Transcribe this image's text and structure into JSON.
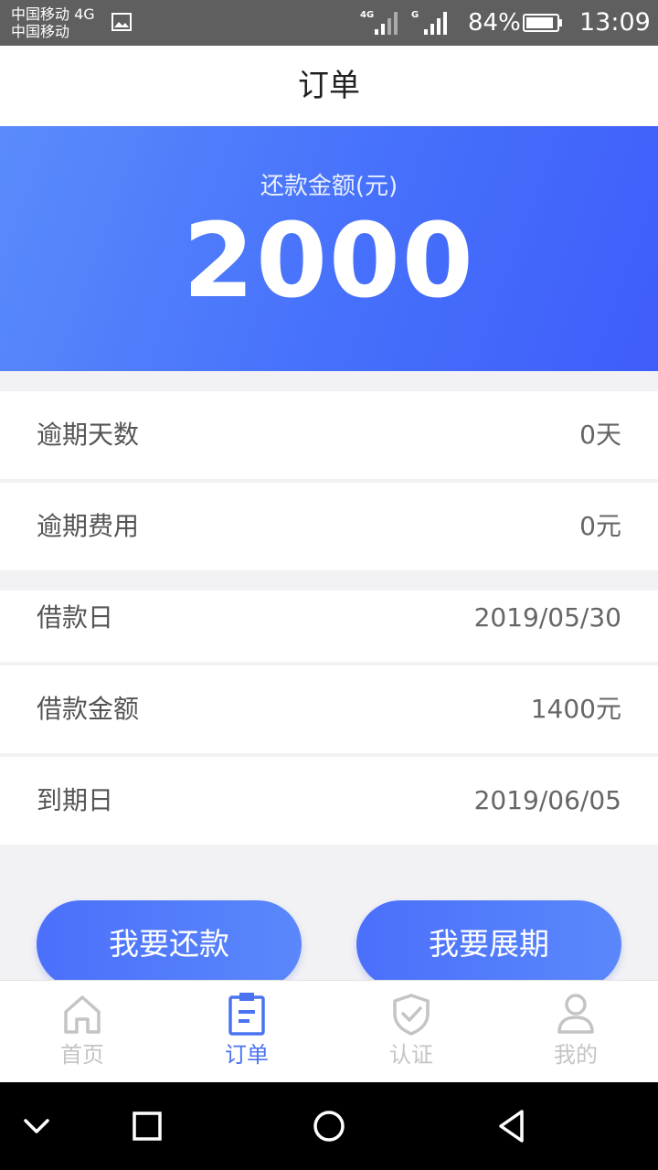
{
  "status_bar": {
    "carrier_line1": "中国移动 4G",
    "carrier_line2": "中国移动",
    "signal1_tag": "4G",
    "signal2_tag": "G",
    "battery": "84%",
    "time": "13:09"
  },
  "header": {
    "title": "订单"
  },
  "summary": {
    "label": "还款金额(元)",
    "amount": "2000"
  },
  "details": [
    {
      "label": "逾期天数",
      "value": "0天"
    },
    {
      "label": "逾期费用",
      "value": "0元"
    },
    {
      "label": "借款日",
      "value": "2019/05/30"
    },
    {
      "label": "借款金额",
      "value": "1400元"
    },
    {
      "label": "到期日",
      "value": "2019/06/05"
    }
  ],
  "actions": {
    "repay": "我要还款",
    "extend": "我要展期"
  },
  "tabs": [
    {
      "label": "首页",
      "icon": "home-icon"
    },
    {
      "label": "订单",
      "icon": "order-icon",
      "active": true
    },
    {
      "label": "认证",
      "icon": "shield-check-icon"
    },
    {
      "label": "我的",
      "icon": "user-icon"
    }
  ],
  "colors": {
    "accent": "#4a73f2",
    "hero_start": "#5a8bfb",
    "hero_end": "#3f5dfa",
    "tab_inactive": "#c4c4c4"
  }
}
